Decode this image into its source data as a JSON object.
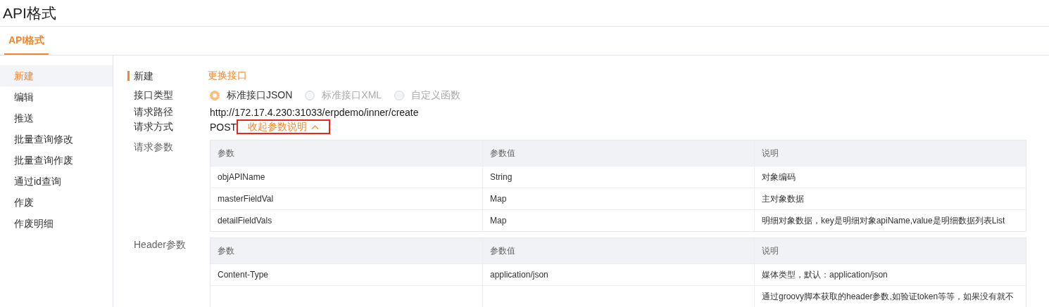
{
  "page_title": "API格式",
  "tabs": [
    {
      "label": "API格式",
      "selected": true
    }
  ],
  "sidebar": {
    "items": [
      {
        "label": "新建",
        "selected": true
      },
      {
        "label": "编辑",
        "selected": false
      },
      {
        "label": "推送",
        "selected": false
      },
      {
        "label": "批量查询修改",
        "selected": false
      },
      {
        "label": "批量查询作废",
        "selected": false
      },
      {
        "label": "通过id查询",
        "selected": false
      },
      {
        "label": "作废",
        "selected": false
      },
      {
        "label": "作废明细",
        "selected": false
      }
    ]
  },
  "section": {
    "title": "新建",
    "action": "更换接口"
  },
  "interface_type": {
    "label": "接口类型",
    "options": [
      {
        "label": "标准接口JSON",
        "selected": true,
        "disabled": false
      },
      {
        "label": "标准接口XML",
        "selected": false,
        "disabled": true
      },
      {
        "label": "自定义函数",
        "selected": false,
        "disabled": true
      }
    ]
  },
  "request_path": {
    "label": "请求路径",
    "value": "http://172.17.4.230:31033/erpdemo/inner/create"
  },
  "request_method": {
    "label": "请求方式",
    "value": "POST",
    "toggle": "收起参数说明",
    "highlighted": true
  },
  "tables": [
    {
      "label": "请求参数",
      "columns": [
        "参数",
        "参数值",
        "说明"
      ],
      "rows": [
        [
          "objAPIName",
          "String",
          "对象编码"
        ],
        [
          "masterFieldVal",
          "Map",
          "主对象数据"
        ],
        [
          "detailFieldVals",
          "Map",
          "明细对象数据，key是明细对象apiName,value是明细数据列表List"
        ]
      ]
    },
    {
      "label": "Header参数",
      "columns": [
        "参数",
        "参数值",
        "说明"
      ],
      "rows": [
        [
          "Content-Type",
          "application/json",
          "媒体类型，默认：application/json"
        ],
        [
          "",
          "",
          "通过groovy脚本获取的header参数,如验证token等等，如果没有就不"
        ]
      ]
    }
  ]
}
